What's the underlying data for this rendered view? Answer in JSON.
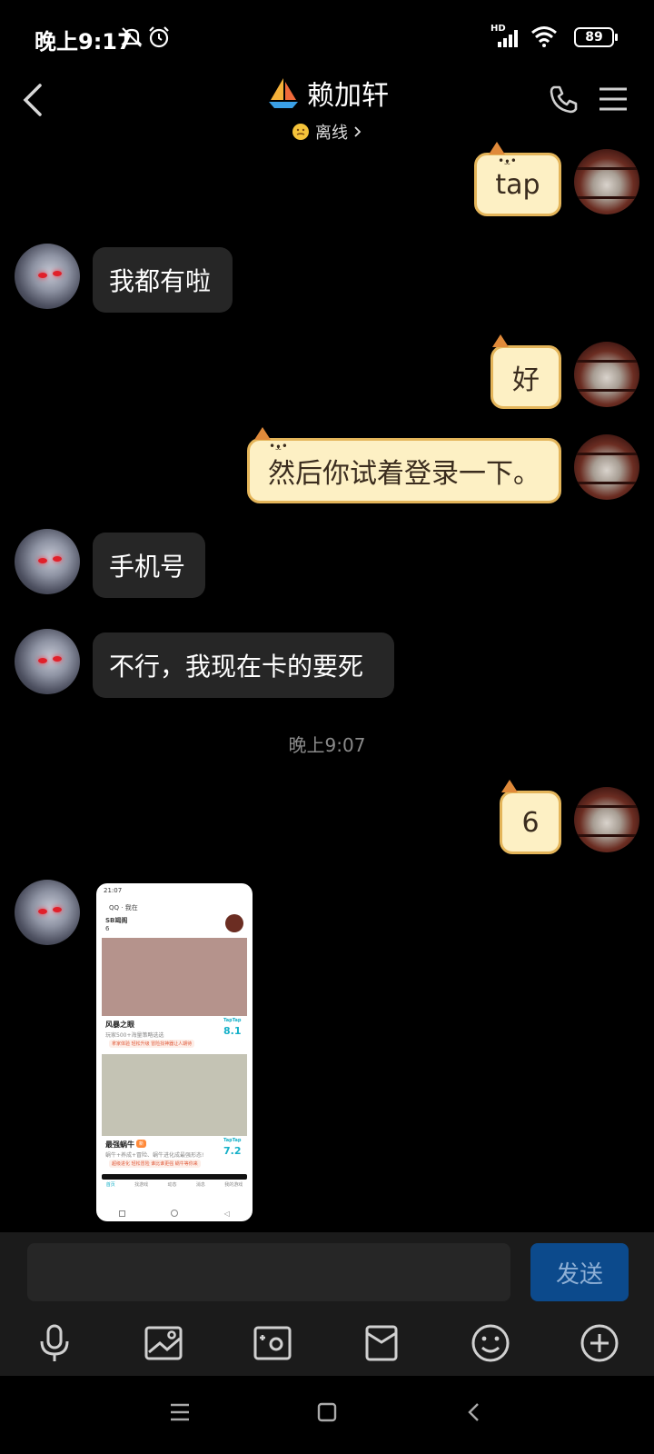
{
  "status_bar": {
    "time": "晚上9:17",
    "battery": "89",
    "network_label": "HD",
    "icons": [
      "bell-muted-icon",
      "alarm-icon",
      "signal-icon",
      "wifi-icon",
      "battery-icon"
    ]
  },
  "header": {
    "title": "赖加轩",
    "status": "离线",
    "icons": [
      "back-icon",
      "sailboat-icon",
      "status-emoji-icon",
      "phone-icon",
      "menu-icon"
    ]
  },
  "messages": [
    {
      "sender": "me",
      "text": "tap"
    },
    {
      "sender": "other",
      "text": "我都有啦"
    },
    {
      "sender": "me",
      "text": "好"
    },
    {
      "sender": "me",
      "text": "然后你试着登录一下。"
    },
    {
      "sender": "other",
      "text": "手机号"
    },
    {
      "sender": "other",
      "text": "不行，我现在卡的要死"
    },
    {
      "sender": "me",
      "text": "6"
    }
  ],
  "timestamp": "晚上9:07",
  "image_message": {
    "mini_time": "21:07",
    "mini_user": "QQ · 我在",
    "mini_header": "SB竭阁",
    "mini_header_count": "6",
    "cards": [
      {
        "title": "风暴之眼",
        "subtitle": "玩家500+海量策略选选",
        "tag": "拿家体验 轻松升级 冒险找神器让人期待",
        "score": "8.1",
        "brand": "TapTap",
        "color": "#b5938c"
      },
      {
        "title": "最强蜗牛",
        "badge": "新",
        "subtitle": "蜗牛+养成+冒险、蜗牛进化成最强形态!",
        "tag": "超级进化 轻松冒险 谁比谁更强 蜗牛等你来",
        "score": "7.2",
        "brand": "TapTap",
        "color": "#c4c3b4"
      }
    ],
    "mini_nav": [
      "首页",
      "找游戏",
      "动态",
      "消息",
      "我的游戏"
    ]
  },
  "input": {
    "placeholder": "",
    "send_label": "发送"
  },
  "toolbar": [
    "microphone-icon",
    "image-icon",
    "camera-icon",
    "red-packet-icon",
    "emoji-icon",
    "plus-icon"
  ],
  "nav_bar": [
    "recent-apps-icon",
    "home-icon",
    "back-icon"
  ],
  "colors": {
    "background": "#000000",
    "other_bubble": "#262626",
    "my_bubble": "#fdf0c4",
    "my_bubble_border": "#e4b55a",
    "send_button": "#0c4a8c"
  }
}
